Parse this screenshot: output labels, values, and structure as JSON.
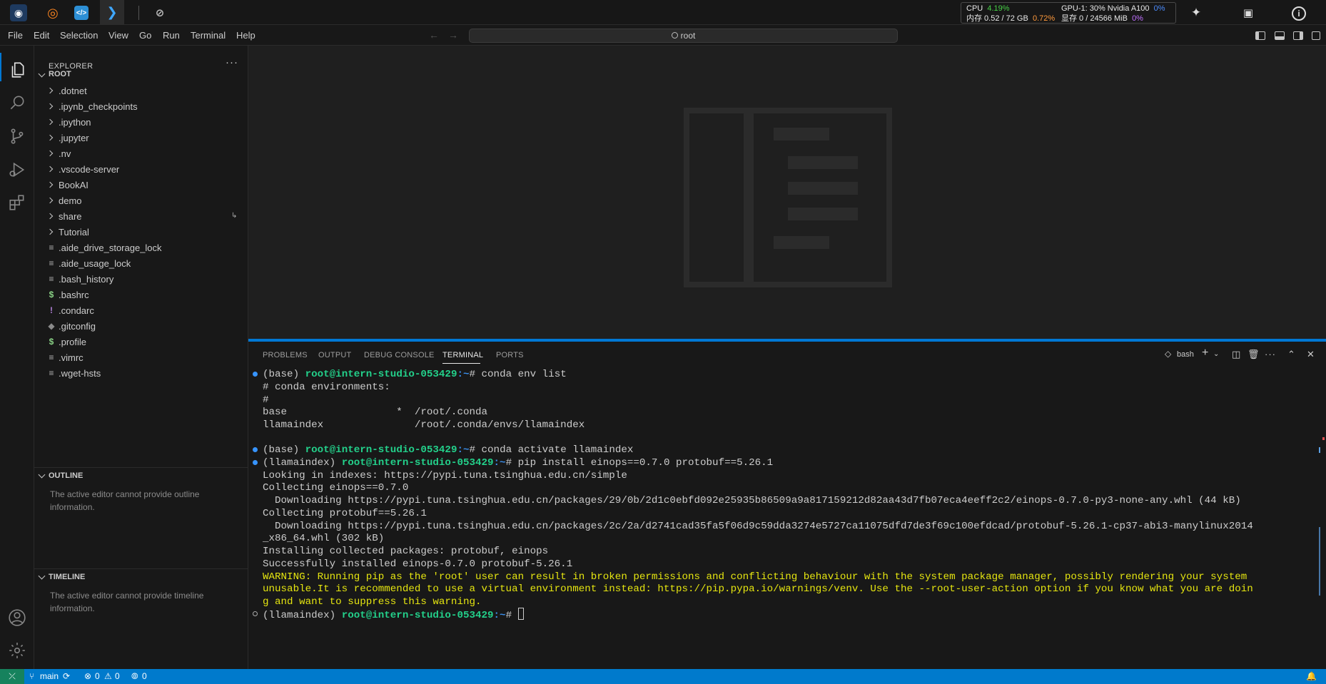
{
  "host_toolbar": {
    "monitor": {
      "cpu_label": "CPU",
      "cpu_value": "4.19%",
      "gpu_text": "GPU-1: 30% Nvidia A100",
      "gpu_value": "0%",
      "mem_label": "内存 0.52 / 72 GB",
      "mem_value": "0.72%",
      "vram_label": "显存 0 / 24566 MiB",
      "vram_value": "0%"
    }
  },
  "menu": {
    "items": [
      "File",
      "Edit",
      "Selection",
      "View",
      "Go",
      "Run",
      "Terminal",
      "Help"
    ],
    "command_center": "root"
  },
  "sidebar": {
    "explorer_title": "EXPLORER",
    "more": "···",
    "root_label": "ROOT",
    "folders": [
      ".dotnet",
      ".ipynb_checkpoints",
      ".ipython",
      ".jupyter",
      ".nv",
      ".vscode-server",
      "BookAI",
      "demo",
      "share",
      "Tutorial"
    ],
    "files": [
      {
        "name": ".aide_drive_storage_lock",
        "icon": "≡"
      },
      {
        "name": ".aide_usage_lock",
        "icon": "≡"
      },
      {
        "name": ".bash_history",
        "icon": "≡"
      },
      {
        "name": ".bashrc",
        "icon": "$"
      },
      {
        "name": ".condarc",
        "icon": "!"
      },
      {
        "name": ".gitconfig",
        "icon": "◆"
      },
      {
        "name": ".profile",
        "icon": "$"
      },
      {
        "name": ".vimrc",
        "icon": "≡"
      },
      {
        "name": ".wget-hsts",
        "icon": "≡"
      }
    ],
    "outline_title": "OUTLINE",
    "outline_msg": "The active editor cannot provide outline information.",
    "timeline_title": "TIMELINE",
    "timeline_msg": "The active editor cannot provide timeline information."
  },
  "panel": {
    "tabs": [
      "PROBLEMS",
      "OUTPUT",
      "DEBUG CONSOLE",
      "TERMINAL",
      "PORTS"
    ],
    "active_tab": "TERMINAL",
    "shell": "bash"
  },
  "terminal": {
    "env1": "(base) ",
    "env2": "(llamaindex) ",
    "user": "root@intern-studio-053429",
    "path": ":~",
    "hash": "# ",
    "cmd1": "conda env list",
    "cmd2": "conda activate llamaindex",
    "cmd3": "pip install einops==0.7.0 protobuf==5.26.1",
    "out1": "# conda environments:",
    "out2": "#",
    "out3": "base                  *  /root/.conda",
    "out4": "llamaindex               /root/.conda/envs/llamaindex",
    "out5": "Looking in indexes: https://pypi.tuna.tsinghua.edu.cn/simple",
    "out6": "Collecting einops==0.7.0",
    "out7": "  Downloading https://pypi.tuna.tsinghua.edu.cn/packages/29/0b/2d1c0ebfd092e25935b86509a9a817159212d82aa43d7fb07eca4eeff2c2/einops-0.7.0-py3-none-any.whl (44 kB)",
    "out8": "Collecting protobuf==5.26.1",
    "out9": "  Downloading https://pypi.tuna.tsinghua.edu.cn/packages/2c/2a/d2741cad35fa5f06d9c59dda3274e5727ca11075dfd7de3f69c100efdcad/protobuf-5.26.1-cp37-abi3-manylinux2014",
    "out10": "_x86_64.whl (302 kB)",
    "out11": "Installing collected packages: protobuf, einops",
    "out12": "Successfully installed einops-0.7.0 protobuf-5.26.1",
    "warn1": "WARNING: Running pip as the 'root' user can result in broken permissions and conflicting behaviour with the system package manager, possibly rendering your system",
    "warn2": "unusable.It is recommended to use a virtual environment instead: https://pip.pypa.io/warnings/venv. Use the --root-user-action option if you know what you are doin",
    "warn3": "g and want to suppress this warning."
  },
  "statusbar": {
    "branch": "main",
    "errors": "0",
    "warnings": "0",
    "ports": "0"
  },
  "colors": {
    "accent": "#0078d4",
    "statusbar": "#007acc",
    "prompt_user": "#23d18b",
    "warning": "#e5e510"
  }
}
